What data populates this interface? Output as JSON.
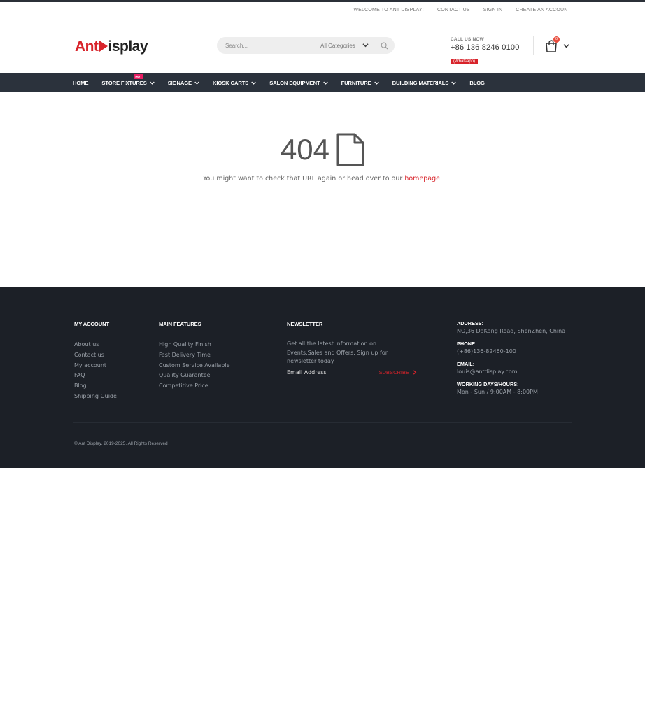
{
  "topbar": {
    "links": [
      "WELCOME TO ANT DISPLAY!",
      "CONTACT US",
      "SIGN IN",
      "CREATE AN ACCOUNT"
    ]
  },
  "header": {
    "logo_part1": "Ant",
    "logo_part2": "isplay",
    "search_placeholder": "Search...",
    "category": "All Categories",
    "call_label": "CALL US NOW",
    "phone": "+86 136 8246 0100",
    "whatsapp": "(Whatsapp)",
    "cart_count": "0"
  },
  "nav": {
    "items": [
      "HOME",
      "STORE FIXTURES",
      "SIGNAGE",
      "KIOSK CARTS",
      "SALON EQUIPMENT",
      "FURNITURE",
      "BUILDING MATERIALS",
      "BLOG"
    ],
    "hot_badge": "HOT"
  },
  "error": {
    "code": "404",
    "message": "You might want to check that URL again or head over to our",
    "link": "homepage",
    "period": "."
  },
  "footer": {
    "account_title": "MY ACCOUNT",
    "account_links": [
      "About us",
      "Contact us",
      "My account",
      "FAQ",
      "Blog",
      "Shipping Guide"
    ],
    "features_title": "MAIN FEATURES",
    "features": [
      "High Quality Finish",
      "Fast Delivery Time",
      "Custom Service Available",
      "Quality Guarantee",
      "Competitive Price"
    ],
    "newsletter_title": "NEWSLETTER",
    "newsletter_text": "Get all the latest information on Events,Sales and Offers. Sign up for newsletter today",
    "email_label": "Email Address",
    "subscribe": "SUBSCRIBE",
    "address_label": "ADDRESS:",
    "address": "NO,36 DaKang Road, ShenZhen, China",
    "phone_label": "PHONE:",
    "phone": "(+86)136-82460-100",
    "email_title": "EMAIL:",
    "email": "louis@antdisplay.com",
    "hours_label": "WORKING DAYS/HOURS:",
    "hours": "Mon - Sun / 9:00AM - 8:00PM",
    "copyright": "© Ant Display. 2019-2025. All Rights Reserved"
  },
  "colors": {
    "brand_red": "#d8232a",
    "nav_bg": "#2b323c",
    "footer_bg": "#1c2027"
  }
}
